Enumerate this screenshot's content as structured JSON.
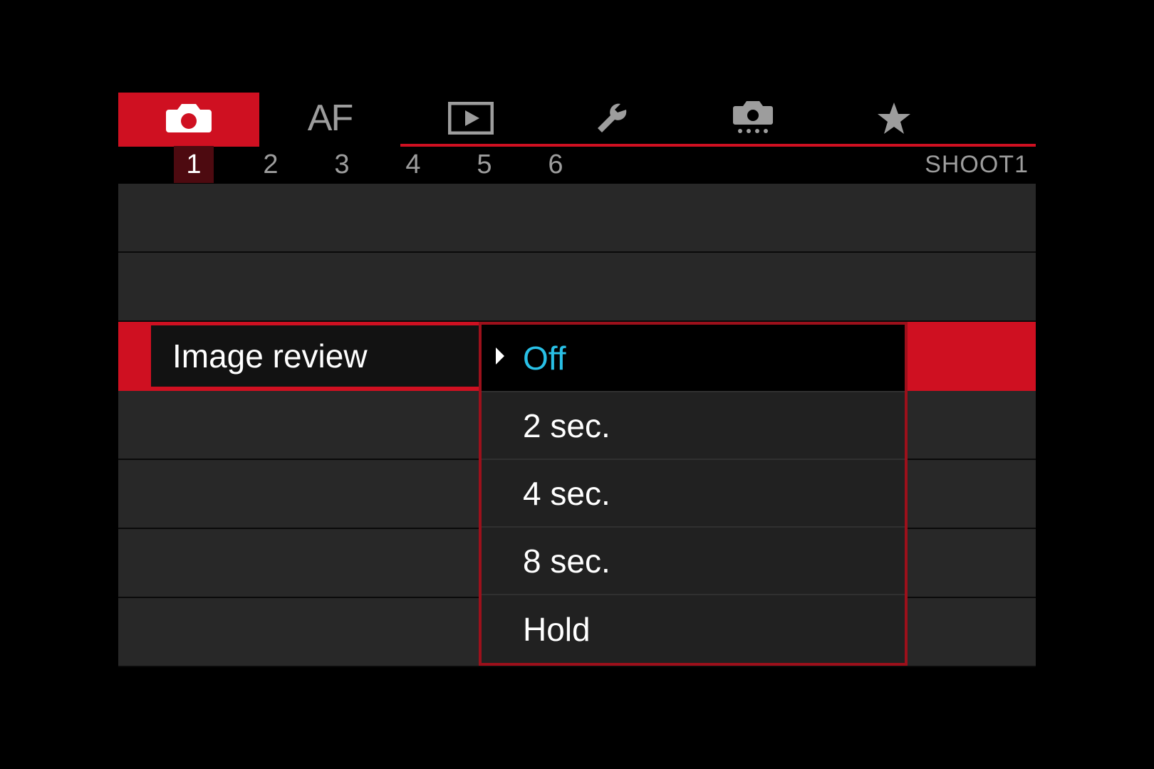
{
  "tabs": {
    "main": {
      "shoot": "camera-icon",
      "af": "AF",
      "play": "play-icon",
      "setup": "wrench-icon",
      "cfn": "custom-camera-icon",
      "mymenu": "star-icon"
    },
    "pages": [
      "1",
      "2",
      "3",
      "4",
      "5",
      "6"
    ],
    "active_page": "1",
    "section_label": "SHOOT1"
  },
  "setting": {
    "label": "Image review",
    "options": [
      "Off",
      "2 sec.",
      "4 sec.",
      "8 sec.",
      "Hold"
    ],
    "selected_index": 0
  },
  "colors": {
    "accent": "#cf1021",
    "cyan": "#29c0e6"
  }
}
